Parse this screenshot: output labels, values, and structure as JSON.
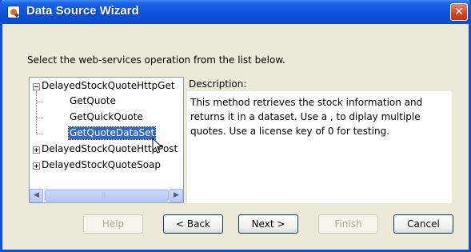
{
  "window": {
    "title": "Data Source Wizard"
  },
  "instruction": "Select the web-services operation from the list below.",
  "tree": {
    "items": [
      {
        "label": "DelayedStockQuoteHttpGet",
        "expanded": true
      },
      {
        "label": "GetQuote"
      },
      {
        "label": "GetQuickQuote"
      },
      {
        "label": "GetQuoteDataSet",
        "selected": true
      },
      {
        "label": "DelayedStockQuoteHttpPost",
        "expanded": false
      },
      {
        "label": "DelayedStockQuoteSoap",
        "expanded": false
      }
    ]
  },
  "description": {
    "label": "Description:",
    "text": "This method retrieves the stock information and returns it in a dataset. Use a , to diplay multiple quotes. Use a license key of 0 for testing."
  },
  "buttons": {
    "help": "Help",
    "back": "< Back",
    "next": "Next >",
    "finish": "Finish",
    "cancel": "Cancel"
  },
  "colors": {
    "titlebar": "#0a52d8",
    "selection": "#316ac5",
    "dialog_bg": "#ece9d8"
  }
}
